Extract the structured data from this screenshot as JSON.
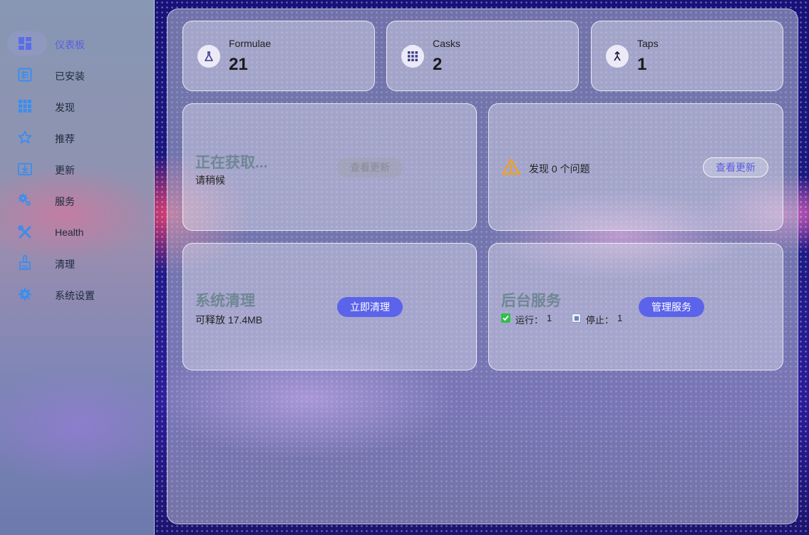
{
  "sidebar": {
    "items": [
      {
        "label": "仪表板",
        "icon": "dashboard-icon"
      },
      {
        "label": "已安装",
        "icon": "installed-list-icon"
      },
      {
        "label": "发现",
        "icon": "discover-grid-icon"
      },
      {
        "label": "推荐",
        "icon": "star-icon"
      },
      {
        "label": "更新",
        "icon": "download-update-icon"
      },
      {
        "label": "服务",
        "icon": "gears-icon"
      },
      {
        "label": "Health",
        "icon": "wrench-screwdriver-icon"
      },
      {
        "label": "清理",
        "icon": "broom-icon"
      },
      {
        "label": "系统设置",
        "icon": "settings-gear-icon"
      }
    ],
    "active_index": 0
  },
  "stats": [
    {
      "label": "Formulae",
      "value": "21",
      "icon": "flask-icon"
    },
    {
      "label": "Casks",
      "value": "2",
      "icon": "grid-icon"
    },
    {
      "label": "Taps",
      "value": "1",
      "icon": "merge-arrow-icon"
    }
  ],
  "updates_card": {
    "title": "正在获取...",
    "subtitle": "请稍候",
    "button": "查看更新"
  },
  "issues_card": {
    "text": "发现 0 个问题",
    "button": "查看更新",
    "icon": "warning-icon"
  },
  "cleanup_card": {
    "title": "系统清理",
    "subtitle": "可释放 17.4MB",
    "button": "立即清理"
  },
  "services_card": {
    "title": "后台服务",
    "running_label": "运行：",
    "running_count": "1",
    "stopped_label": "停止：",
    "stopped_count": "1",
    "button": "管理服务"
  },
  "colors": {
    "accent": "#5b63ea",
    "sidebar_icon": "#3a8df0",
    "warning": "#f0a020",
    "running_check": "#2fbf4a"
  }
}
